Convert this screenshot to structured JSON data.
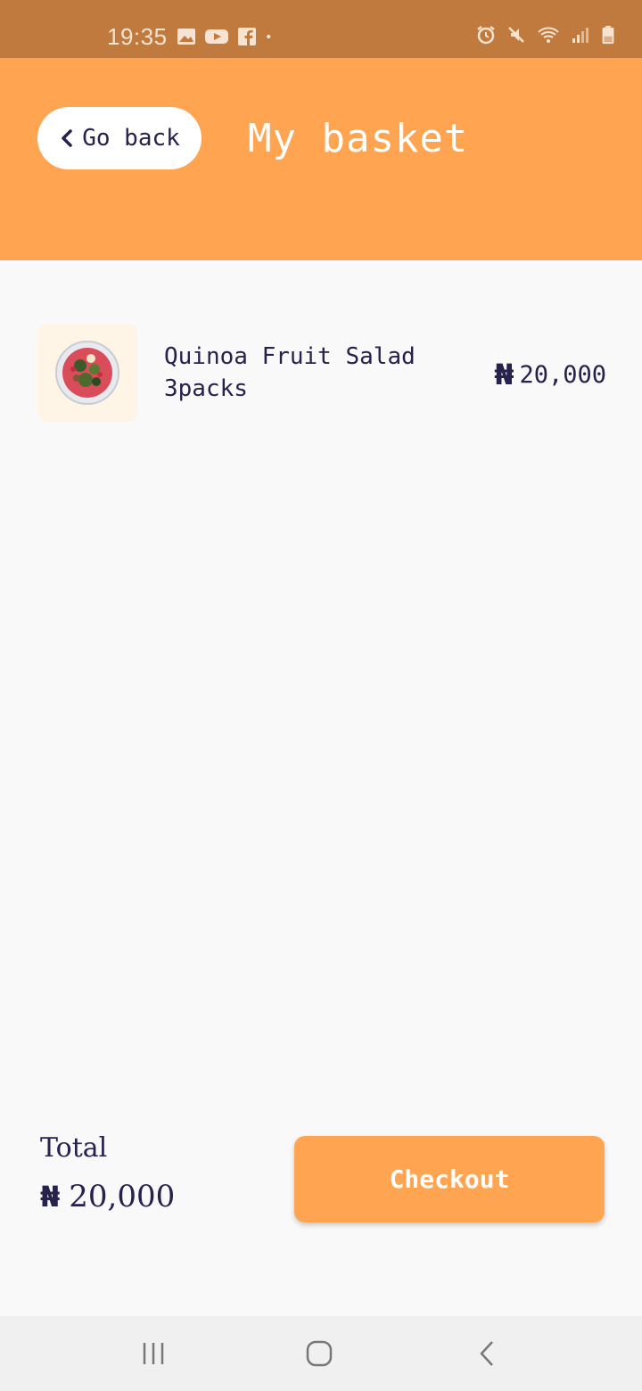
{
  "status_bar": {
    "time": "19:35",
    "left_icons": [
      "gallery-icon",
      "youtube-icon",
      "facebook-icon",
      "dot-icon"
    ],
    "right_icons": [
      "alarm-icon",
      "mute-icon",
      "wifi-icon",
      "signal-icon",
      "battery-icon"
    ]
  },
  "header": {
    "back_label": "Go back",
    "title": "My basket"
  },
  "basket": {
    "items": [
      {
        "name": "Quinoa Fruit Salad",
        "quantity": "3packs",
        "currency": "₦",
        "price": "20,000"
      }
    ]
  },
  "footer": {
    "total_label": "Total",
    "currency": "₦",
    "total_value": "20,000",
    "checkout_label": "Checkout"
  },
  "colors": {
    "accent": "#ffa451",
    "status_bar": "#c07a3e",
    "text_dark": "#27214d",
    "background": "#f9f9f9"
  }
}
